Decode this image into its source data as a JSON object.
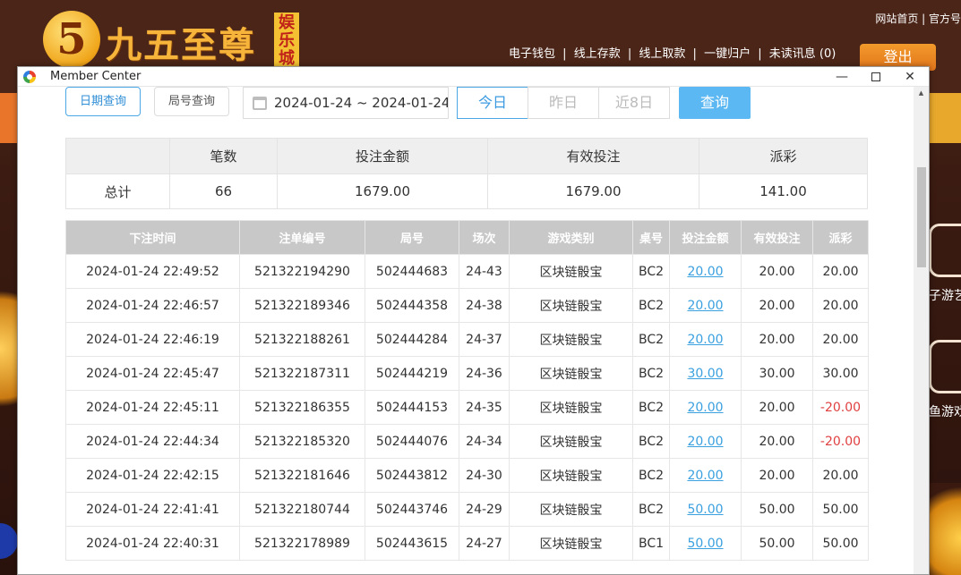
{
  "site": {
    "logo_mark": "5",
    "logo_text": "九五至尊",
    "logo_badge": "娱乐城",
    "top_links": "网站首页 | 官方号",
    "nav": [
      "电子钱包",
      "|",
      "线上存款",
      "|",
      "线上取款",
      "|",
      "一键归户",
      "|",
      "未读讯息 (0)"
    ],
    "login_label": "登出",
    "side_labels": [
      "子游艺",
      "鱼游戏"
    ]
  },
  "window": {
    "title": "Member Center",
    "min_glyph": "—",
    "close_glyph": "✕",
    "scroll_up_glyph": "▲"
  },
  "filters": {
    "tab_date": "日期查询",
    "tab_round": "局号查询",
    "date_range": "2024-01-24 ~ 2024-01-24",
    "today": "今日",
    "yesterday": "昨日",
    "last8": "近8日",
    "query": "查询"
  },
  "summary": {
    "headers": [
      "",
      "笔数",
      "投注金额",
      "有效投注",
      "派彩"
    ],
    "row": [
      "总计",
      "66",
      "1679.00",
      "1679.00",
      "141.00"
    ]
  },
  "details": {
    "headers": [
      "下注时间",
      "注单编号",
      "局号",
      "场次",
      "游戏类别",
      "桌号",
      "投注金额",
      "有效投注",
      "派彩"
    ],
    "rows": [
      [
        "2024-01-24 22:49:52",
        "521322194290",
        "502444683",
        "24-43",
        "区块链骰宝",
        "BC2",
        "20.00",
        "20.00",
        "20.00"
      ],
      [
        "2024-01-24 22:46:57",
        "521322189346",
        "502444358",
        "24-38",
        "区块链骰宝",
        "BC2",
        "20.00",
        "20.00",
        "20.00"
      ],
      [
        "2024-01-24 22:46:19",
        "521322188261",
        "502444284",
        "24-37",
        "区块链骰宝",
        "BC2",
        "20.00",
        "20.00",
        "20.00"
      ],
      [
        "2024-01-24 22:45:47",
        "521322187311",
        "502444219",
        "24-36",
        "区块链骰宝",
        "BC2",
        "30.00",
        "30.00",
        "30.00"
      ],
      [
        "2024-01-24 22:45:11",
        "521322186355",
        "502444153",
        "24-35",
        "区块链骰宝",
        "BC2",
        "20.00",
        "20.00",
        "-20.00"
      ],
      [
        "2024-01-24 22:44:34",
        "521322185320",
        "502444076",
        "24-34",
        "区块链骰宝",
        "BC2",
        "20.00",
        "20.00",
        "-20.00"
      ],
      [
        "2024-01-24 22:42:15",
        "521322181646",
        "502443812",
        "24-30",
        "区块链骰宝",
        "BC2",
        "20.00",
        "20.00",
        "20.00"
      ],
      [
        "2024-01-24 22:41:41",
        "521322180744",
        "502443746",
        "24-29",
        "区块链骰宝",
        "BC2",
        "50.00",
        "50.00",
        "50.00"
      ],
      [
        "2024-01-24 22:40:31",
        "521322178989",
        "502443615",
        "24-27",
        "区块链骰宝",
        "BC1",
        "50.00",
        "50.00",
        "50.00"
      ]
    ]
  },
  "colors": {
    "accent": "#5cb8f2",
    "link": "#3aa0e0",
    "negative": "#e04040",
    "header_gray": "#c8c8c8"
  }
}
